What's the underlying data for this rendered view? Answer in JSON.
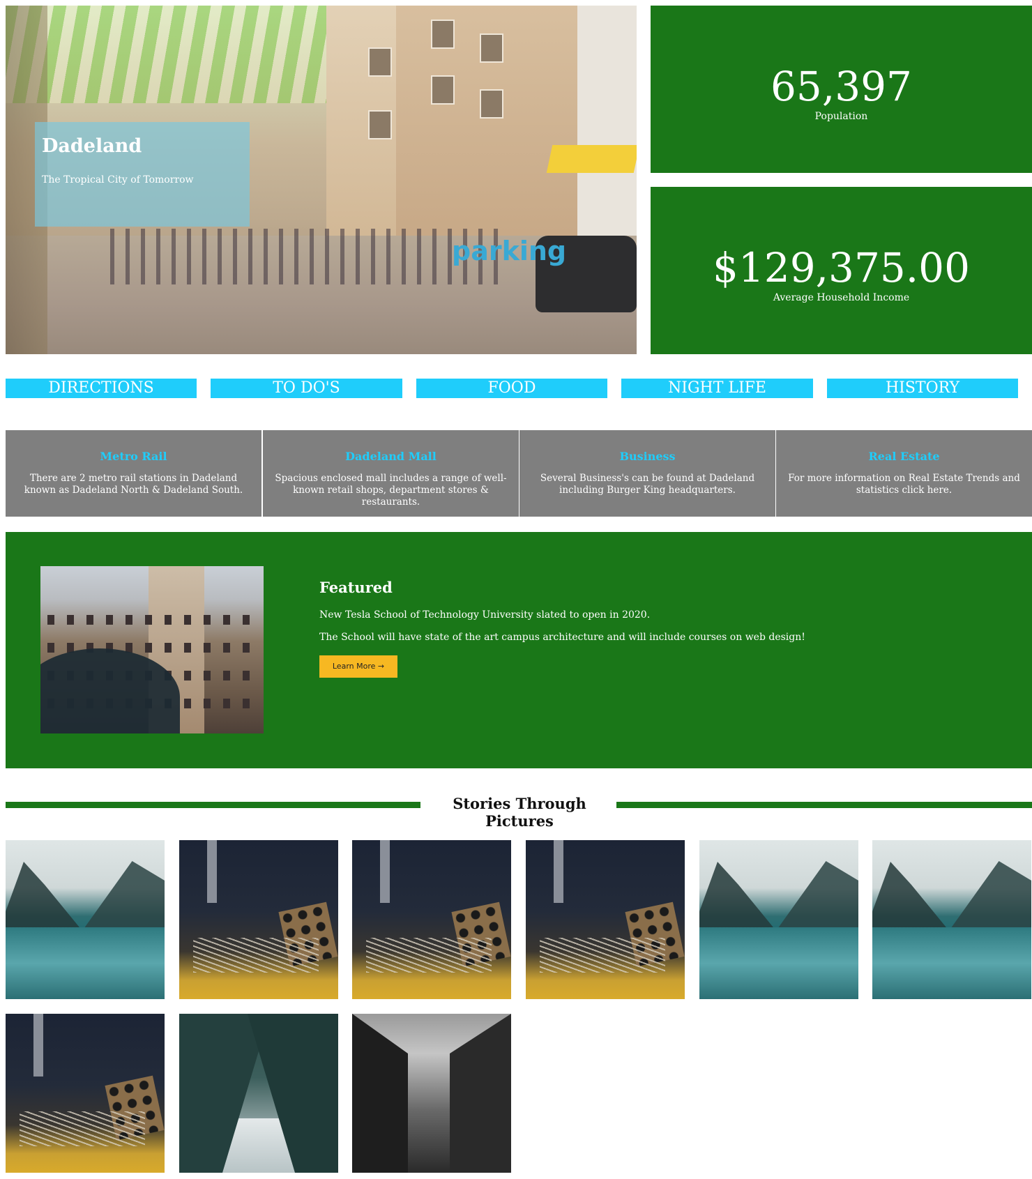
{
  "hero": {
    "title": "Dadeland",
    "subtitle": "The Tropical City of Tomorrow",
    "sign_text": "parking"
  },
  "stats": [
    {
      "value": "65,397",
      "label": "Population"
    },
    {
      "value": "$129,375.00",
      "label": "Average Household Income"
    }
  ],
  "nav": [
    "DIRECTIONS",
    "TO DO'S",
    "FOOD",
    "NIGHT LIFE",
    "HISTORY"
  ],
  "info_cards": [
    {
      "title": "Metro Rail",
      "text": "There are 2 metro rail stations in Dadeland known as Dadeland North & Dadeland South."
    },
    {
      "title": "Dadeland Mall",
      "text": "Spacious enclosed mall includes a range of well-known retail shops, department stores & restaurants."
    },
    {
      "title": "Business",
      "text": "Several Business's can be found at Dadeland including Burger King headquarters."
    },
    {
      "title": "Real Estate",
      "text": "For more information on Real Estate Trends and statistics click here."
    }
  ],
  "featured": {
    "title": "Featured",
    "p1": "New Tesla School of Technology University slated to open in 2020.",
    "p2": "The School will have state of the art campus architecture and will include courses on web design!",
    "button": "Learn More →"
  },
  "stories": {
    "title": "Stories Through Pictures"
  },
  "colors": {
    "green": "#1a7718",
    "cyan": "#1fcdfb",
    "gray": "#7f7f7f",
    "yellow": "#f7b822"
  }
}
